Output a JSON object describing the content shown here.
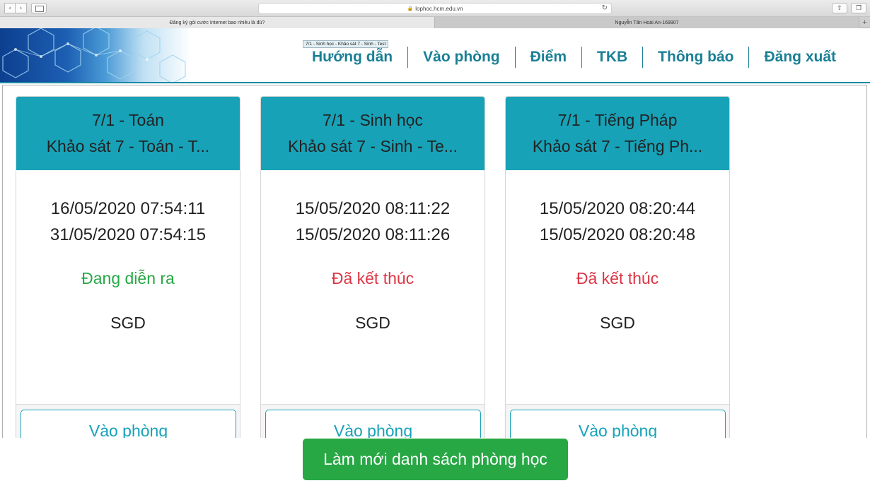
{
  "browser": {
    "url": "lophoc.hcm.edu.vn",
    "tabs": [
      {
        "title": "Đăng ký gói cước Internet bao nhiêu là đủ?"
      },
      {
        "title": "Nguyễn Tấn Hoài An-169907"
      }
    ],
    "icons": {
      "back": "chevron-left-icon",
      "forward": "chevron-right-icon",
      "sidebar": "sidebar-icon",
      "lock": "lock-icon",
      "reload": "reload-icon",
      "share": "share-icon",
      "tabs": "tabs-icon",
      "new_tab": "plus-icon"
    }
  },
  "header": {
    "nav": [
      "Hướng dẫn",
      "Vào phòng",
      "Điểm",
      "TKB",
      "Thông báo",
      "Đăng xuất"
    ]
  },
  "rooms": [
    {
      "title": "7/1 - Toán",
      "subtitle": "Khảo sát 7 - Toán - T...",
      "start": "16/05/2020 07:54:11",
      "end": "31/05/2020 07:54:15",
      "status": "Đang diễn ra",
      "status_color": "#28a745",
      "owner": "SGD",
      "button": "Vào phòng"
    },
    {
      "title": "7/1 - Sinh học",
      "subtitle": "Khảo sát 7 - Sinh - Te...",
      "start": "15/05/2020 08:11:22",
      "end": "15/05/2020 08:11:26",
      "status": "Đã kết thúc",
      "status_color": "#dc3545",
      "owner": "SGD",
      "button": "Vào phòng"
    },
    {
      "title": "7/1 - Tiếng Pháp",
      "subtitle": "Khảo sát 7 - Tiếng Ph...",
      "start": "15/05/2020 08:20:44",
      "end": "15/05/2020 08:20:48",
      "status": "Đã kết thúc",
      "status_color": "#dc3545",
      "owner": "SGD",
      "button": "Vào phòng"
    }
  ],
  "tooltip": "7/1 - Sinh học - Khảo sát 7 - Sinh - Test",
  "refresh_button": "Làm mới danh sách phòng học",
  "colors": {
    "primary": "#17a2b8",
    "nav": "#1a7f95",
    "success": "#28a745",
    "danger": "#dc3545"
  }
}
